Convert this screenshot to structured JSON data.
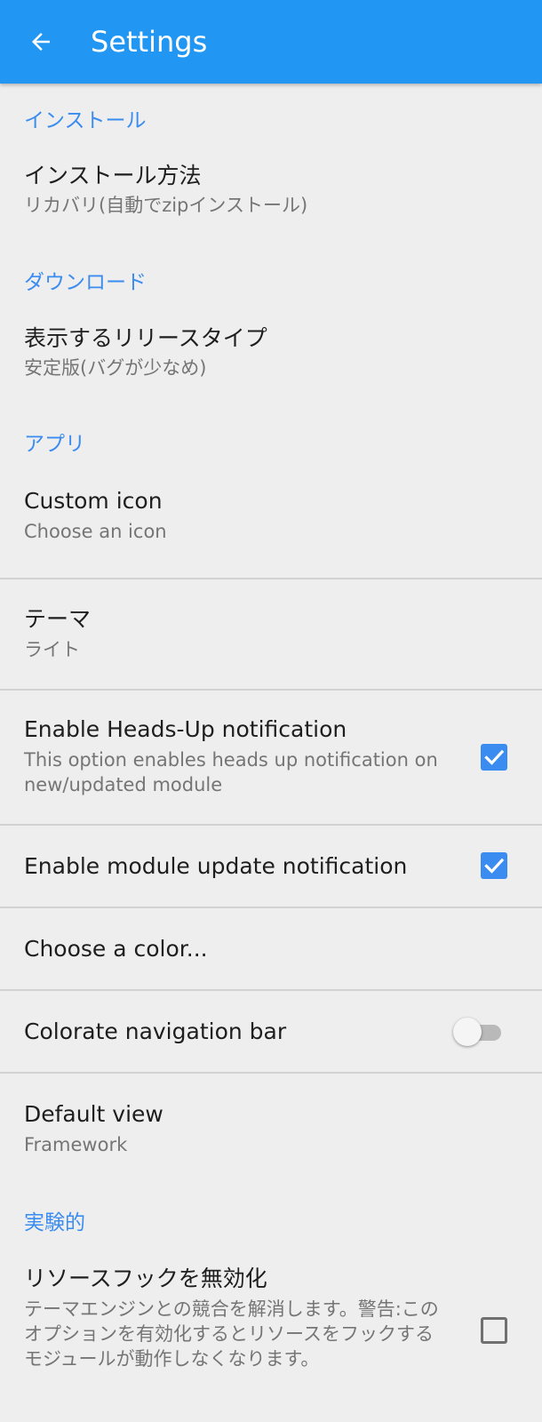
{
  "appbar": {
    "title": "Settings",
    "back_icon": "arrow-left-icon",
    "background": "#2196f3"
  },
  "accent_color": "#3b8cf0",
  "sections": {
    "install": {
      "header": "インストール",
      "install_method": {
        "title": "インストール方法",
        "summary": "リカバリ(自動でzipインストール)"
      }
    },
    "download": {
      "header": "ダウンロード",
      "release_type": {
        "title": "表示するリリースタイプ",
        "summary": "安定版(バグが少なめ)"
      }
    },
    "app": {
      "header": "アプリ",
      "custom_icon": {
        "title": "Custom icon",
        "summary": "Choose an icon"
      },
      "theme": {
        "title": "テーマ",
        "summary": "ライト"
      },
      "heads_up": {
        "title": "Enable Heads-Up notification",
        "summary": "This option enables heads up notification on new/updated module",
        "checked": true
      },
      "module_update": {
        "title": "Enable module update notification",
        "checked": true
      },
      "choose_color": {
        "title": "Choose a color..."
      },
      "colorate_nav": {
        "title": "Colorate navigation bar",
        "enabled": false
      },
      "default_view": {
        "title": "Default view",
        "summary": "Framework"
      }
    },
    "experimental": {
      "header": "実験的",
      "disable_resource_hooks": {
        "title": "リソースフックを無効化",
        "summary": "テーマエンジンとの競合を解消します。警告:このオプションを有効化するとリソースをフックするモジュールが動作しなくなります。",
        "checked": false
      }
    }
  }
}
